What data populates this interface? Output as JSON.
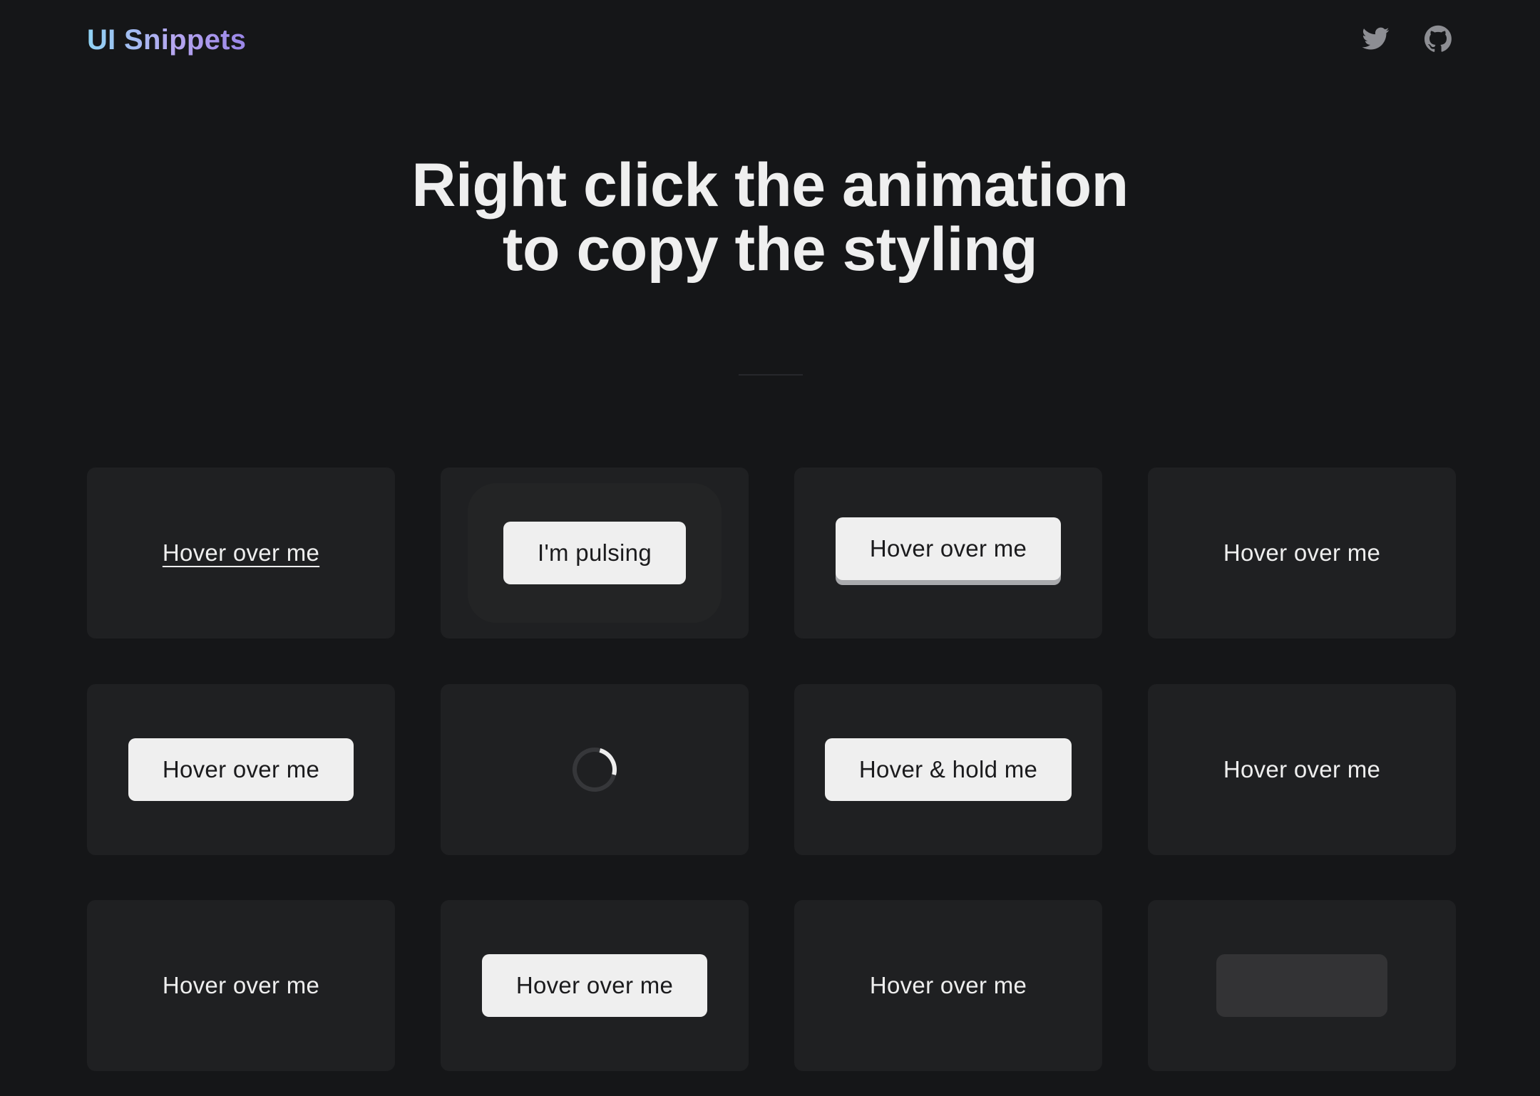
{
  "header": {
    "logo": "UI Snippets",
    "twitter_icon": "twitter-icon",
    "github_icon": "github-icon"
  },
  "hero": {
    "line1": "Right click the animation",
    "line2": "to copy the styling"
  },
  "cards": [
    {
      "label": "Hover over me",
      "style": "white-underline-link"
    },
    {
      "label": "I'm pulsing",
      "style": "pulsing-button"
    },
    {
      "label": "Hover over me",
      "style": "pressable-button"
    },
    {
      "label": "Hover over me",
      "style": "purple-underline-link"
    },
    {
      "label": "Hover over me",
      "style": "button"
    },
    {
      "label": "",
      "style": "spinner"
    },
    {
      "label": "Hover & hold me",
      "style": "button"
    },
    {
      "label": "Hover over me",
      "style": "text"
    },
    {
      "label": "Hover over me",
      "style": "text"
    },
    {
      "label": "Hover over me",
      "style": "button"
    },
    {
      "label": "Hover over me",
      "style": "text"
    },
    {
      "label": "",
      "style": "ghost-button"
    }
  ],
  "colors": {
    "background": "#151618",
    "card": "#1f2022",
    "button": "#efefef",
    "accent_purple": "#5a5390",
    "logo_gradient_start": "#8fd3f4",
    "logo_gradient_end": "#9a86e8"
  }
}
